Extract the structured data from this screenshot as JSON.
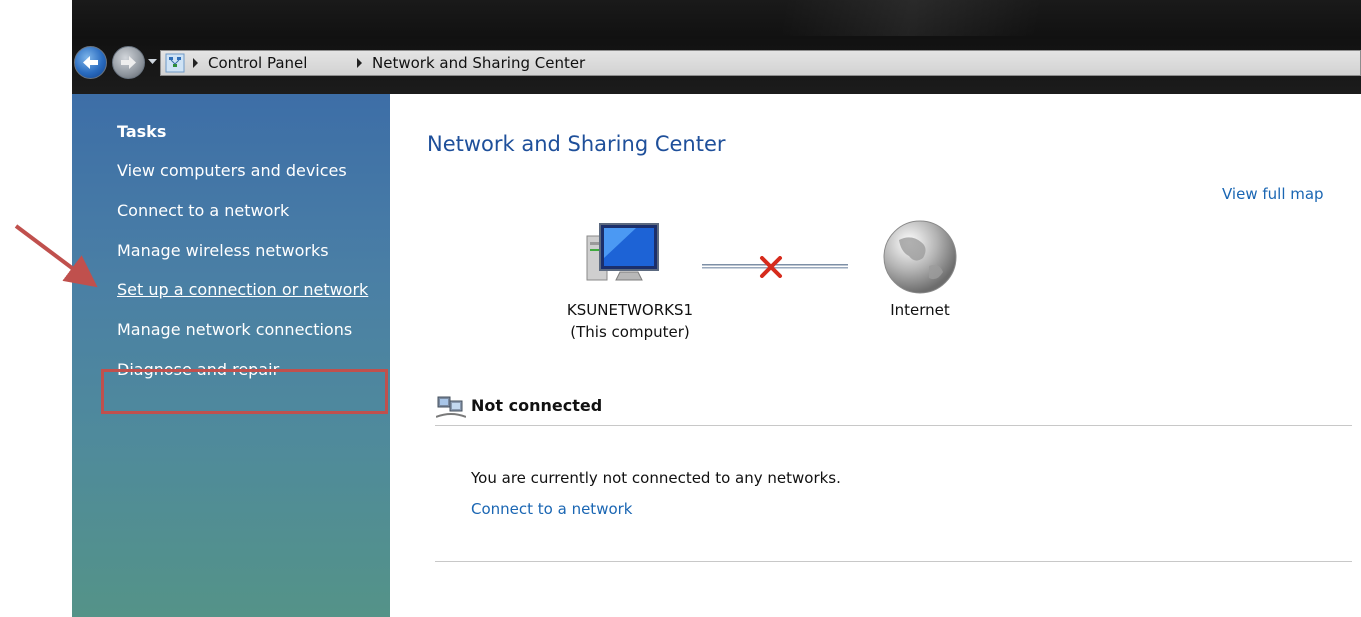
{
  "address_bar": {
    "breadcrumbs": [
      "Control Panel",
      "Network and Sharing Center"
    ]
  },
  "sidebar": {
    "heading": "Tasks",
    "links": [
      "View computers and devices",
      "Connect to a network",
      "Manage wireless networks",
      "Set up a connection or network",
      "Manage network connections",
      "Diagnose and repair"
    ],
    "highlighted_link": "Set up a connection or network"
  },
  "main": {
    "title": "Network and Sharing Center",
    "view_full_map": "View full map",
    "network_map": {
      "computer_name": "KSUNETWORKS1",
      "computer_subtitle": "(This computer)",
      "internet_label": "Internet",
      "connection_state_icon": "red-x-icon"
    },
    "status": {
      "title": "Not connected",
      "message": "You are currently not connected to any networks.",
      "connect_link": "Connect to a network"
    }
  },
  "colors": {
    "link": "#1a66b3",
    "title": "#1e4f9a",
    "highlight": "#c0504d",
    "sidebar_top": "#3d6ea7",
    "sidebar_bottom": "#549388"
  }
}
